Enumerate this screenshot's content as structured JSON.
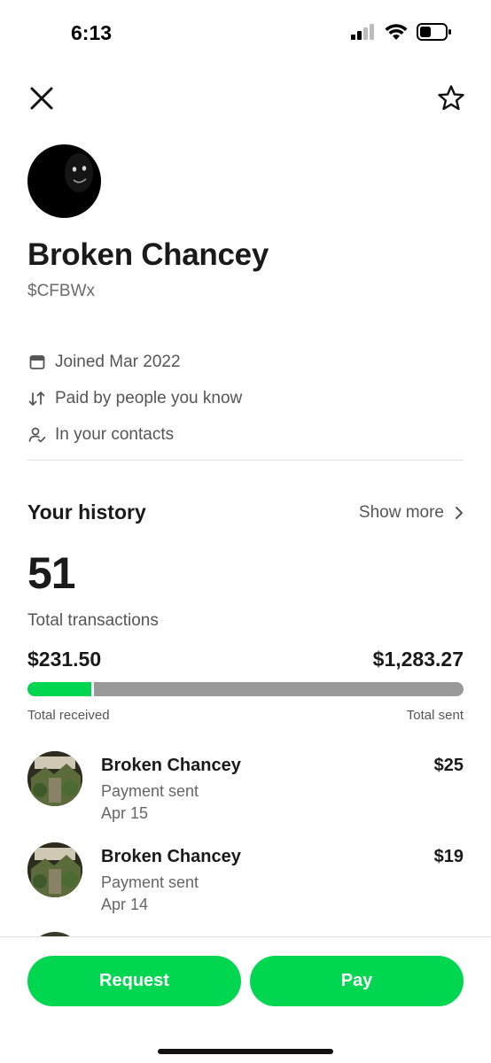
{
  "status_bar": {
    "time": "6:13",
    "icons": [
      "signal-icon",
      "wifi-icon",
      "battery-icon"
    ]
  },
  "nav": {
    "icons": [
      "close-icon",
      "star-icon"
    ]
  },
  "profile": {
    "name": "Broken Chancey",
    "cashtag": "$CFBWx",
    "meta": [
      {
        "icon": "calendar-icon",
        "text": "Joined Mar 2022"
      },
      {
        "icon": "arrows-up-down-icon",
        "text": "Paid by people you know"
      },
      {
        "icon": "contact-check-icon",
        "text": "In your contacts"
      }
    ]
  },
  "history": {
    "title": "Your history",
    "show_more": "Show more",
    "total_count": "51",
    "total_label": "Total transactions",
    "received_amount": "$231.50",
    "sent_amount": "$1,283.27",
    "received_label": "Total received",
    "sent_label": "Total sent",
    "received_fraction": 0.153
  },
  "transactions": [
    {
      "name": "Broken Chancey",
      "type": "Payment sent",
      "date": "Apr 15",
      "amount": "$25"
    },
    {
      "name": "Broken Chancey",
      "type": "Payment sent",
      "date": "Apr 14",
      "amount": "$19"
    }
  ],
  "actions": {
    "request_label": "Request",
    "pay_label": "Pay"
  },
  "colors": {
    "accent": "#00d64f",
    "bar_track": "#999999",
    "text_primary": "#1a1a1a",
    "text_secondary": "#555555"
  }
}
